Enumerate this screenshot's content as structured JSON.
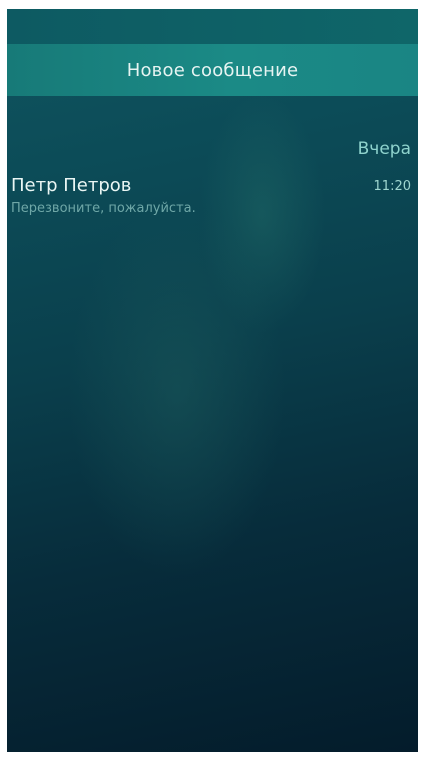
{
  "pull_menu": {
    "label": "Новое сообщение"
  },
  "conversations": {
    "section_header": "Вчера",
    "items": [
      {
        "sender": "Петр Петров",
        "preview": "Перезвоните, пожалуйста.",
        "time": "11:20"
      }
    ]
  }
}
